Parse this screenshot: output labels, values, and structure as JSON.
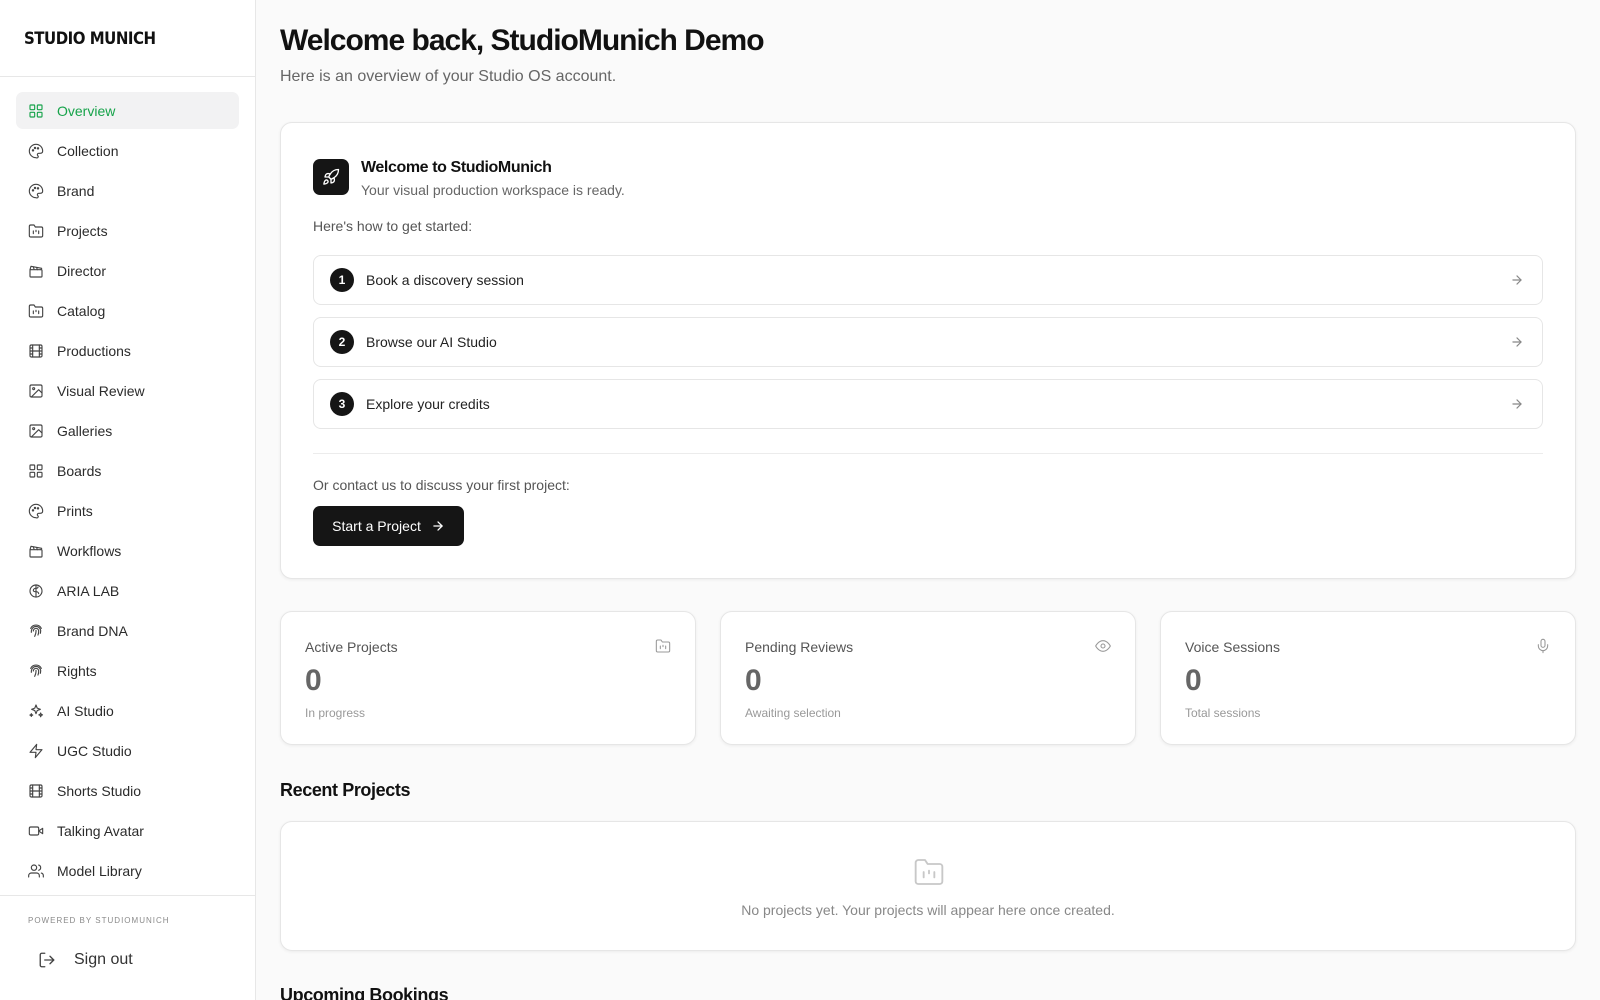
{
  "app": {
    "logo": "STUDIO MUNICH",
    "powered_by": "POWERED BY STUDIOMUNICH",
    "sign_out": "Sign out"
  },
  "colors": {
    "accent": "#16a34a",
    "dark": "#151515"
  },
  "sidebar": {
    "items": [
      {
        "label": "Overview",
        "icon": "grid-icon",
        "active": true
      },
      {
        "label": "Collection",
        "icon": "palette-icon"
      },
      {
        "label": "Brand",
        "icon": "palette-icon"
      },
      {
        "label": "Projects",
        "icon": "folder-icon"
      },
      {
        "label": "Director",
        "icon": "clapperboard-icon"
      },
      {
        "label": "Catalog",
        "icon": "folder-icon"
      },
      {
        "label": "Productions",
        "icon": "film-icon"
      },
      {
        "label": "Visual Review",
        "icon": "image-icon"
      },
      {
        "label": "Galleries",
        "icon": "image-icon"
      },
      {
        "label": "Boards",
        "icon": "grid-icon"
      },
      {
        "label": "Prints",
        "icon": "palette-icon"
      },
      {
        "label": "Workflows",
        "icon": "clapperboard-icon"
      },
      {
        "label": "ARIA LAB",
        "icon": "brain-icon"
      },
      {
        "label": "Brand DNA",
        "icon": "fingerprint-icon"
      },
      {
        "label": "Rights",
        "icon": "fingerprint-icon"
      },
      {
        "label": "AI Studio",
        "icon": "sparkles-icon"
      },
      {
        "label": "UGC Studio",
        "icon": "zap-icon"
      },
      {
        "label": "Shorts Studio",
        "icon": "film-icon"
      },
      {
        "label": "Talking Avatar",
        "icon": "video-icon"
      },
      {
        "label": "Model Library",
        "icon": "users-icon"
      }
    ]
  },
  "header": {
    "title": "Welcome back, StudioMunich Demo",
    "subtitle": "Here is an overview of your Studio OS account."
  },
  "welcome": {
    "title": "Welcome to StudioMunich",
    "subtitle": "Your visual production workspace is ready.",
    "how_to": "Here's how to get started:",
    "steps": [
      {
        "num": "1",
        "label": "Book a discovery session"
      },
      {
        "num": "2",
        "label": "Browse our AI Studio"
      },
      {
        "num": "3",
        "label": "Explore your credits"
      }
    ],
    "contact": "Or contact us to discuss your first project:",
    "cta": "Start a Project"
  },
  "stats": [
    {
      "label": "Active Projects",
      "value": "0",
      "hint": "In progress",
      "icon": "folder-icon"
    },
    {
      "label": "Pending Reviews",
      "value": "0",
      "hint": "Awaiting selection",
      "icon": "eye-icon"
    },
    {
      "label": "Voice Sessions",
      "value": "0",
      "hint": "Total sessions",
      "icon": "mic-icon"
    }
  ],
  "recent": {
    "title": "Recent Projects",
    "empty": "No projects yet. Your projects will appear here once created."
  },
  "bookings": {
    "title": "Upcoming Bookings"
  }
}
